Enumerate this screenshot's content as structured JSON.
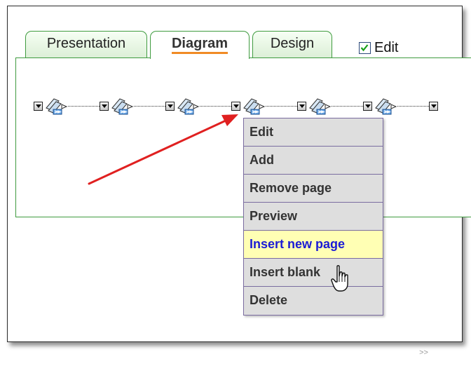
{
  "tabs": [
    {
      "label": "Presentation",
      "active": false
    },
    {
      "label": "Diagram",
      "active": true
    },
    {
      "label": "Design",
      "active": false
    }
  ],
  "edit_toggle": {
    "label": "Edit",
    "checked": true
  },
  "diagram": {
    "icon": "page-flow-icon",
    "dropdown_icon": "dropdown-arrow-icon"
  },
  "context_menu": {
    "items": [
      {
        "label": "Edit",
        "highlighted": false
      },
      {
        "label": "Add",
        "highlighted": false
      },
      {
        "label": "Remove page",
        "highlighted": false
      },
      {
        "label": "Preview",
        "highlighted": false
      },
      {
        "label": "Insert new page",
        "highlighted": true
      },
      {
        "label": "Insert blank",
        "highlighted": false
      },
      {
        "label": "Delete",
        "highlighted": false
      }
    ]
  },
  "colors": {
    "tab_border": "#3f9b3f",
    "active_underline": "#f08a25",
    "menu_highlight_bg": "#ffffb4",
    "menu_highlight_text": "#1b1bd6",
    "annotation_arrow": "#e02020"
  },
  "watermark": {
    "text": ">>"
  }
}
